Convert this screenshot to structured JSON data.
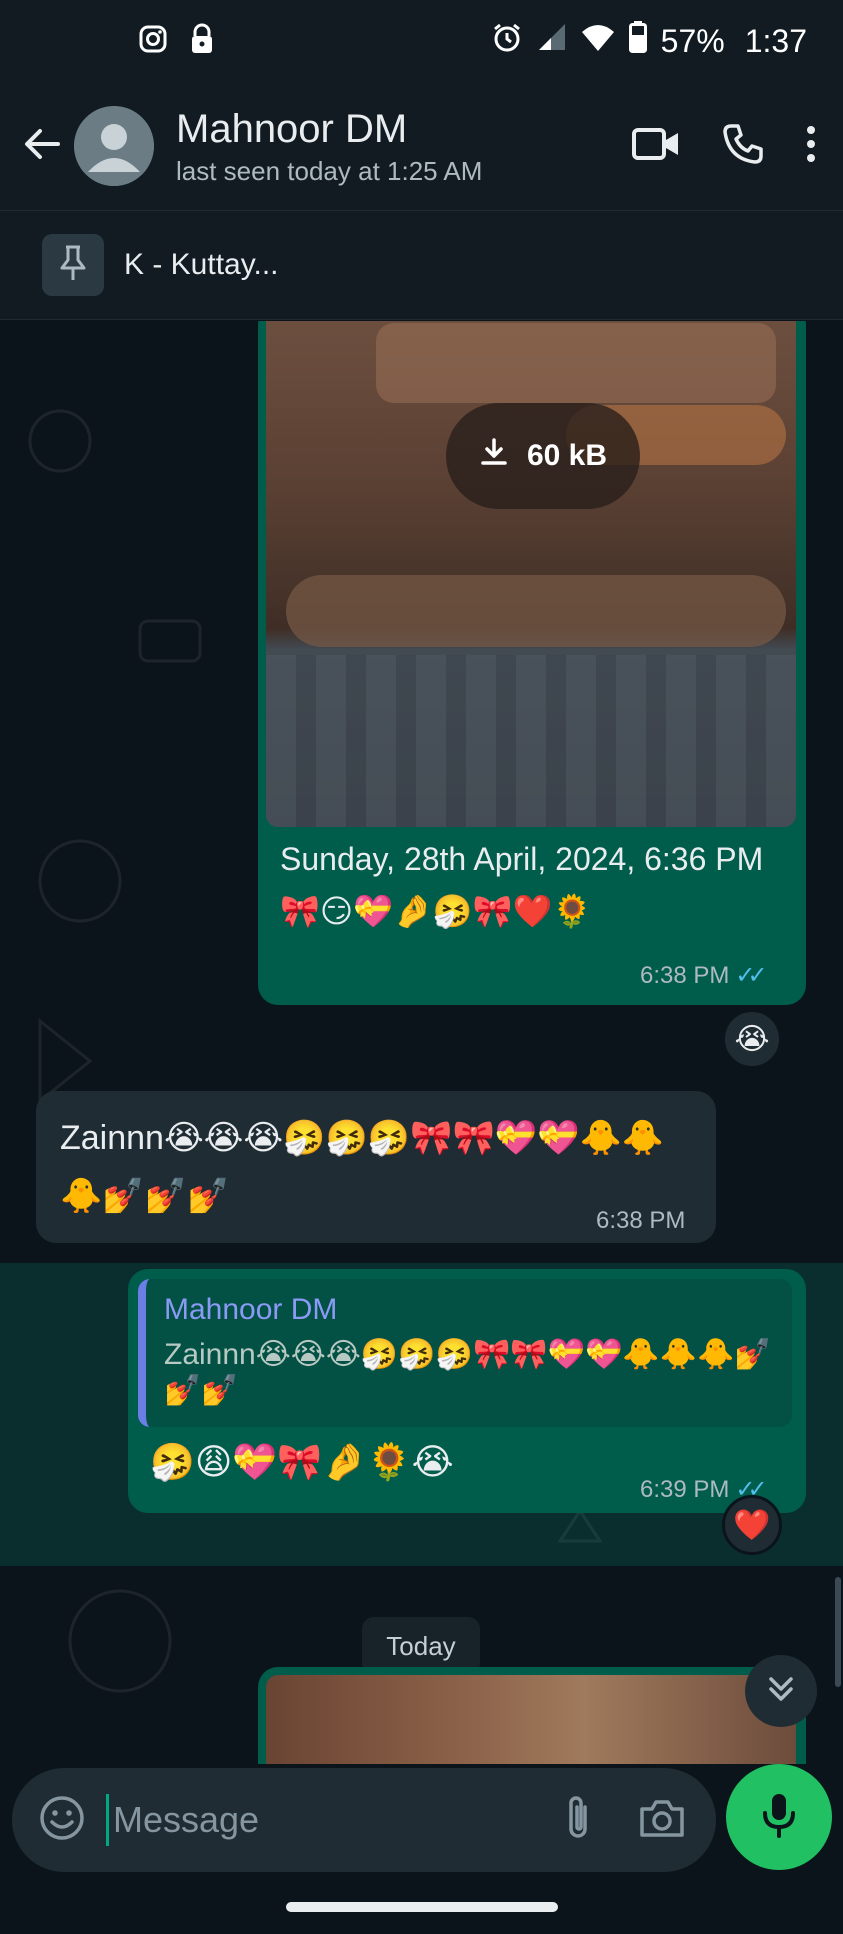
{
  "status_bar": {
    "battery": "57%",
    "time": "1:37",
    "icons": [
      "instagram-icon",
      "lock-icon",
      "alarm-icon",
      "signal-icon",
      "wifi-icon",
      "battery-icon"
    ]
  },
  "header": {
    "contact_name": "Mahnoor DM",
    "last_seen": "last seen today at 1:25 AM",
    "icons": [
      "back-arrow-icon",
      "avatar-icon",
      "video-call-icon",
      "phone-icon",
      "more-vert-icon"
    ]
  },
  "pinned": {
    "text": "K - Kuttay..."
  },
  "messages": {
    "m1": {
      "download_size": "60 kB",
      "caption": "Sunday, 28th April, 2024, 6:36 PM 🎀😏💝🤌🤧🎀❤️🌻",
      "time": "6:38 PM",
      "reaction": "😭"
    },
    "m2": {
      "text": "Zainnn😭😭😭🤧🤧🤧🎀🎀💝💝🐥🐥🐥💅💅💅",
      "time": "6:38 PM"
    },
    "m3": {
      "quote_author": "Mahnoor DM",
      "quote_text": "Zainnn😭😭😭🤧🤧🤧🎀🎀💝💝🐥🐥🐥💅💅💅",
      "text": "🤧😩💝🎀🤌🌻😭",
      "time": "6:39 PM",
      "reaction": "❤️"
    }
  },
  "date_chip": "Today",
  "composer": {
    "placeholder": "Message"
  },
  "colors": {
    "outgoing_bubble": "#005c4b",
    "incoming_bubble": "#202c33",
    "accent": "#21c063",
    "read_ticks": "#53bdeb"
  }
}
